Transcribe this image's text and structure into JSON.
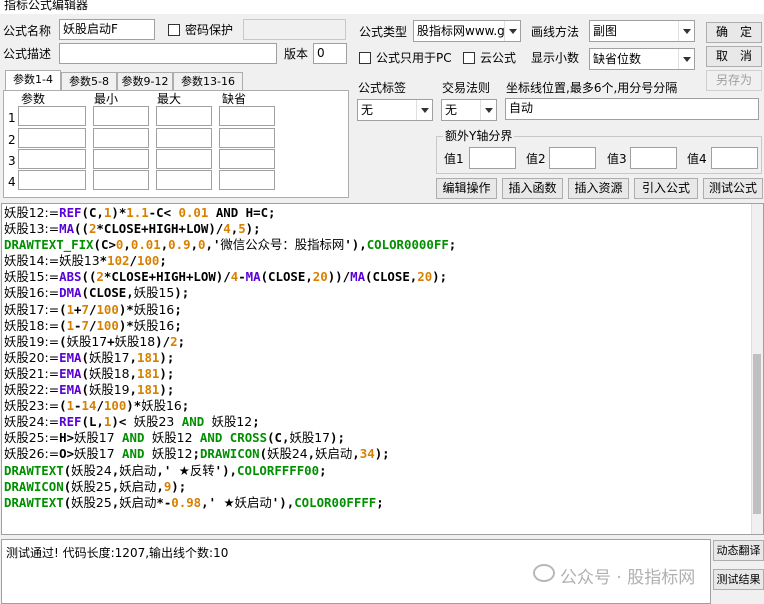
{
  "window": {
    "title": "指标公式编辑器"
  },
  "formula": {
    "name_label": "公式名称",
    "name_value": "妖股启动F",
    "password_label": "密码保护",
    "desc_label": "公式描述",
    "desc_value": "",
    "version_label": "版本",
    "version_value": "0",
    "type_label": "公式类型",
    "type_value": "股指标网www.g",
    "draw_label": "画线方法",
    "draw_value": "副图",
    "pc_only_label": "公式只用于PC",
    "cloud_label": "云公式",
    "decimals_label": "显示小数",
    "decimals_value": "缺省位数"
  },
  "buttons": {
    "ok": "确　定",
    "cancel": "取　消",
    "save_as": "另存为"
  },
  "params": {
    "tabs": [
      "参数1-4",
      "参数5-8",
      "参数9-12",
      "参数13-16"
    ],
    "headers": [
      "参数",
      "最小",
      "最大",
      "缺省"
    ],
    "rows": [
      "1",
      "2",
      "3",
      "4"
    ]
  },
  "tags": {
    "tag_label": "公式标签",
    "tag_value": "无",
    "trade_label": "交易法则",
    "trade_value": "无",
    "coord_label": "坐标线位置,最多6个,用分号分隔",
    "coord_value": "自动"
  },
  "yaxis": {
    "title": "额外Y轴分界",
    "labels": [
      "值1",
      "值2",
      "值3",
      "值4"
    ]
  },
  "actions": [
    "编辑操作",
    "插入函数",
    "插入资源",
    "引入公式",
    "测试公式"
  ],
  "code_lines": [
    [
      [
        "妖股12:=",
        "v"
      ],
      [
        "REF",
        "f"
      ],
      [
        "(C,",
        "b"
      ],
      [
        "1",
        "n"
      ],
      [
        ")*",
        "b"
      ],
      [
        "1.1",
        "n"
      ],
      [
        "-C< ",
        "b"
      ],
      [
        "0.01",
        "n"
      ],
      [
        " AND H=C;",
        "b"
      ]
    ],
    [
      [
        "妖股13:=",
        "v"
      ],
      [
        "MA",
        "f"
      ],
      [
        "((",
        "b"
      ],
      [
        "2",
        "n"
      ],
      [
        "*CLOSE+HIGH+LOW)/",
        "b"
      ],
      [
        "4",
        "n"
      ],
      [
        ",",
        "b"
      ],
      [
        "5",
        "n"
      ],
      [
        ");",
        "b"
      ]
    ],
    [
      [
        "DRAWTEXT_FIX",
        "k"
      ],
      [
        "(C>",
        "b"
      ],
      [
        "0",
        "n"
      ],
      [
        ",",
        "b"
      ],
      [
        "0.01",
        "n"
      ],
      [
        ",",
        "b"
      ],
      [
        "0.9",
        "n"
      ],
      [
        ",",
        "b"
      ],
      [
        "0",
        "n"
      ],
      [
        ",'",
        "b"
      ],
      [
        "微信公众号：股指标网",
        "v"
      ],
      [
        "'),",
        "b"
      ],
      [
        "COLOR0000FF",
        "k"
      ],
      [
        ";",
        "b"
      ]
    ],
    [
      [
        "妖股14:=",
        "v"
      ],
      [
        "妖股13",
        "v"
      ],
      [
        "*",
        "b"
      ],
      [
        "102",
        "n"
      ],
      [
        "/",
        "b"
      ],
      [
        "100",
        "n"
      ],
      [
        ";",
        "b"
      ]
    ],
    [
      [
        "妖股15:=",
        "v"
      ],
      [
        "ABS",
        "f"
      ],
      [
        "((",
        "b"
      ],
      [
        "2",
        "n"
      ],
      [
        "*CLOSE+HIGH+LOW)/",
        "b"
      ],
      [
        "4",
        "n"
      ],
      [
        "-",
        "b"
      ],
      [
        "MA",
        "f"
      ],
      [
        "(CLOSE,",
        "b"
      ],
      [
        "20",
        "n"
      ],
      [
        "))/",
        "b"
      ],
      [
        "MA",
        "f"
      ],
      [
        "(CLOSE,",
        "b"
      ],
      [
        "20",
        "n"
      ],
      [
        ");",
        "b"
      ]
    ],
    [
      [
        "妖股16:=",
        "v"
      ],
      [
        "DMA",
        "f"
      ],
      [
        "(CLOSE,",
        "b"
      ],
      [
        "妖股15",
        "v"
      ],
      [
        ");",
        "b"
      ]
    ],
    [
      [
        "妖股17:=",
        "v"
      ],
      [
        "(",
        "b"
      ],
      [
        "1",
        "n"
      ],
      [
        "+",
        "b"
      ],
      [
        "7",
        "n"
      ],
      [
        "/",
        "b"
      ],
      [
        "100",
        "n"
      ],
      [
        ")*",
        "b"
      ],
      [
        "妖股16",
        "v"
      ],
      [
        ";",
        "b"
      ]
    ],
    [
      [
        "妖股18:=",
        "v"
      ],
      [
        "(",
        "b"
      ],
      [
        "1",
        "n"
      ],
      [
        "-",
        "b"
      ],
      [
        "7",
        "n"
      ],
      [
        "/",
        "b"
      ],
      [
        "100",
        "n"
      ],
      [
        ")*",
        "b"
      ],
      [
        "妖股16",
        "v"
      ],
      [
        ";",
        "b"
      ]
    ],
    [
      [
        "妖股19:=",
        "v"
      ],
      [
        "(",
        "b"
      ],
      [
        "妖股17",
        "v"
      ],
      [
        "+",
        "b"
      ],
      [
        "妖股18",
        "v"
      ],
      [
        ")/",
        "b"
      ],
      [
        "2",
        "n"
      ],
      [
        ";",
        "b"
      ]
    ],
    [
      [
        "妖股20:=",
        "v"
      ],
      [
        "EMA",
        "f"
      ],
      [
        "(",
        "b"
      ],
      [
        "妖股17",
        "v"
      ],
      [
        ",",
        "b"
      ],
      [
        "181",
        "n"
      ],
      [
        ");",
        "b"
      ]
    ],
    [
      [
        "妖股21:=",
        "v"
      ],
      [
        "EMA",
        "f"
      ],
      [
        "(",
        "b"
      ],
      [
        "妖股18",
        "v"
      ],
      [
        ",",
        "b"
      ],
      [
        "181",
        "n"
      ],
      [
        ");",
        "b"
      ]
    ],
    [
      [
        "妖股22:=",
        "v"
      ],
      [
        "EMA",
        "f"
      ],
      [
        "(",
        "b"
      ],
      [
        "妖股19",
        "v"
      ],
      [
        ",",
        "b"
      ],
      [
        "181",
        "n"
      ],
      [
        ");",
        "b"
      ]
    ],
    [
      [
        "妖股23:=",
        "v"
      ],
      [
        "(",
        "b"
      ],
      [
        "1",
        "n"
      ],
      [
        "-",
        "b"
      ],
      [
        "14",
        "n"
      ],
      [
        "/",
        "b"
      ],
      [
        "100",
        "n"
      ],
      [
        ")*",
        "b"
      ],
      [
        "妖股16",
        "v"
      ],
      [
        ";",
        "b"
      ]
    ],
    [
      [
        "妖股24:=",
        "v"
      ],
      [
        "REF",
        "f"
      ],
      [
        "(L,",
        "b"
      ],
      [
        "1",
        "n"
      ],
      [
        ")< ",
        "b"
      ],
      [
        "妖股23",
        "v"
      ],
      [
        " AND ",
        "k"
      ],
      [
        "妖股12",
        "v"
      ],
      [
        ";",
        "b"
      ]
    ],
    [
      [
        "妖股25:=",
        "v"
      ],
      [
        "H>",
        "b"
      ],
      [
        "妖股17",
        "v"
      ],
      [
        " AND ",
        "k"
      ],
      [
        "妖股12",
        "v"
      ],
      [
        " AND ",
        "k"
      ],
      [
        "CROSS",
        "k"
      ],
      [
        "(C,",
        "b"
      ],
      [
        "妖股17",
        "v"
      ],
      [
        ");",
        "b"
      ]
    ],
    [
      [
        "妖股26:=",
        "v"
      ],
      [
        "O>",
        "b"
      ],
      [
        "妖股17",
        "v"
      ],
      [
        " AND ",
        "k"
      ],
      [
        "妖股12",
        "v"
      ],
      [
        ";",
        "b"
      ],
      [
        "DRAWICON",
        "k"
      ],
      [
        "(",
        "b"
      ],
      [
        "妖股24",
        "v"
      ],
      [
        ",",
        "b"
      ],
      [
        "妖启动",
        "v"
      ],
      [
        ",",
        "b"
      ],
      [
        "34",
        "n"
      ],
      [
        ");",
        "b"
      ]
    ],
    [
      [
        "DRAWTEXT",
        "k"
      ],
      [
        "(",
        "b"
      ],
      [
        "妖股24",
        "v"
      ],
      [
        ",",
        "b"
      ],
      [
        "妖启动",
        "v"
      ],
      [
        ",' ",
        "b"
      ],
      [
        "★反转",
        "v"
      ],
      [
        "'),",
        "b"
      ],
      [
        "COLORFFFF00",
        "k"
      ],
      [
        ";",
        "b"
      ]
    ],
    [
      [
        "DRAWICON",
        "k"
      ],
      [
        "(",
        "b"
      ],
      [
        "妖股25",
        "v"
      ],
      [
        ",",
        "b"
      ],
      [
        "妖启动",
        "v"
      ],
      [
        ",",
        "b"
      ],
      [
        "9",
        "n"
      ],
      [
        ");",
        "b"
      ]
    ],
    [
      [
        "DRAWTEXT",
        "k"
      ],
      [
        "(",
        "b"
      ],
      [
        "妖股25",
        "v"
      ],
      [
        ",",
        "b"
      ],
      [
        "妖启动",
        "v"
      ],
      [
        "*-",
        "b"
      ],
      [
        "0.98",
        "n"
      ],
      [
        ",' ",
        "b"
      ],
      [
        "★妖启动",
        "v"
      ],
      [
        "'),",
        "b"
      ],
      [
        "COLOR00FFFF",
        "k"
      ],
      [
        ";",
        "b"
      ]
    ]
  ],
  "status": {
    "message": "测试通过! 代码长度:1207,输出线个数:10"
  },
  "side_buttons": [
    "动态翻译",
    "测试结果"
  ],
  "watermark": {
    "text": "公众号 · 股指标网"
  }
}
